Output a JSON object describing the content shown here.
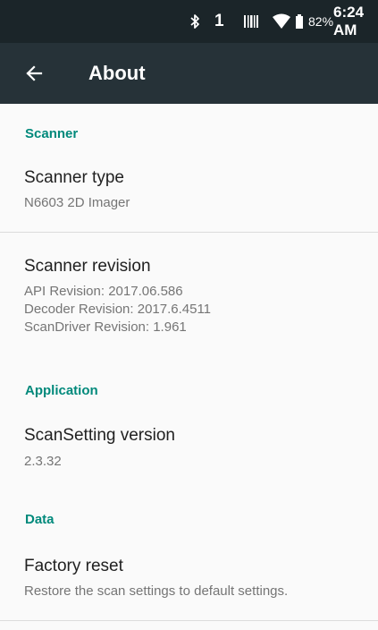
{
  "status_bar": {
    "bluetooth_icon": "bluetooth-icon",
    "indicator_1": "1",
    "battery_percent": "82%",
    "time": "6:24 AM"
  },
  "app_bar": {
    "title": "About"
  },
  "sections": {
    "scanner": {
      "header": "Scanner",
      "scanner_type": {
        "title": "Scanner type",
        "summary": "N6603 2D Imager"
      },
      "scanner_revision": {
        "title": "Scanner revision",
        "lines": [
          "API Revision: 2017.06.586",
          "Decoder Revision: 2017.6.4511",
          "ScanDriver Revision: 1.961"
        ]
      }
    },
    "application": {
      "header": "Application",
      "scansetting_version": {
        "title": "ScanSetting version",
        "summary": "2.3.32"
      }
    },
    "data": {
      "header": "Data",
      "factory_reset": {
        "title": "Factory reset",
        "summary": "Restore the scan settings to default settings."
      }
    }
  },
  "colors": {
    "status_bar": "#1b2529",
    "app_bar": "#263238",
    "accent": "#00897b",
    "background": "#fafafa",
    "divider": "#dcdcdc"
  }
}
